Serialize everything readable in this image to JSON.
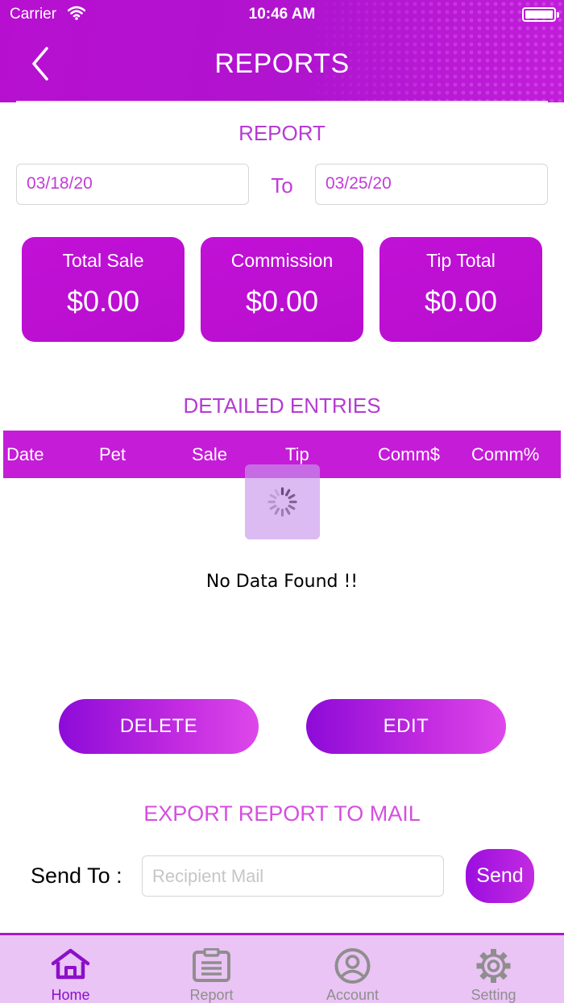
{
  "status_bar": {
    "carrier": "Carrier",
    "time": "10:46 AM"
  },
  "header": {
    "title": "REPORTS",
    "back_icon": "chevron-left-icon"
  },
  "report": {
    "title": "REPORT",
    "from_date": "03/18/20",
    "to_label": "To",
    "to_date": "03/25/20"
  },
  "stats": [
    {
      "label": "Total Sale",
      "value": "$0.00"
    },
    {
      "label": "Commission",
      "value": "$0.00"
    },
    {
      "label": "Tip Total",
      "value": "$0.00"
    }
  ],
  "entries": {
    "title": "DETAILED ENTRIES",
    "columns": [
      "Date",
      "Pet",
      "Sale",
      "Tip",
      "Comm$",
      "Comm%"
    ],
    "empty_message": "No Data Found !!"
  },
  "actions": {
    "delete_label": "DELETE",
    "edit_label": "EDIT"
  },
  "export": {
    "title": "EXPORT REPORT TO MAIL",
    "send_to_label": "Send To :",
    "recipient_placeholder": "Recipient Mail",
    "recipient_value": "",
    "send_label": "Send"
  },
  "tabs": [
    {
      "label": "Home",
      "icon": "home-icon",
      "active": true
    },
    {
      "label": "Report",
      "icon": "clipboard-icon",
      "active": false
    },
    {
      "label": "Account",
      "icon": "user-circle-icon",
      "active": false
    },
    {
      "label": "Setting",
      "icon": "gear-icon",
      "active": false
    }
  ],
  "colors": {
    "brand": "#b70fd0",
    "accent_text": "#c33bd9",
    "tab_active": "#8a10c9",
    "tab_bar_bg": "#eac4f4"
  }
}
